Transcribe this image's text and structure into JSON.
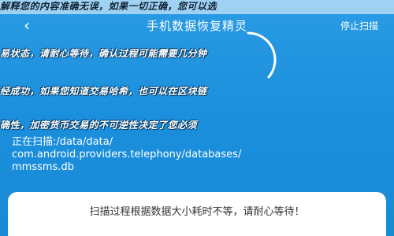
{
  "app": {
    "title": "手机数据恢复精灵",
    "back_icon": "chevron-left-icon",
    "stop_label": "停止扫描"
  },
  "overlays": [
    "解释您的内容准确无误，如果一切正确，您可以选",
    "易状态，请耐心等待，确认过程可能需要几分钟",
    "经成功，如果您知道交易哈希，也可以在区块链",
    "确性，加密货币交易的不可逆性决定了您必须"
  ],
  "scan": {
    "label": "正在扫描:",
    "path_lines": [
      "/data/data/",
      "com.android.providers.telephony/databases/",
      "mmssms.db"
    ]
  },
  "notice": {
    "text": "扫描过程根据数据大小耗时不等，请耐心等待！"
  },
  "colors": {
    "background": "#1b8fdc",
    "ring": "#ffffff",
    "sheet": "#ffffff"
  }
}
